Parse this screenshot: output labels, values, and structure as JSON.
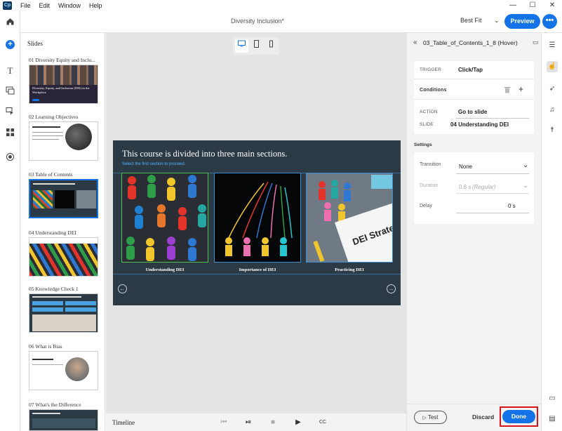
{
  "menubar": {
    "app_icon": "Cp",
    "items": [
      "File",
      "Edit",
      "Window",
      "Help"
    ]
  },
  "window_controls": {
    "minimize": "—",
    "maximize": "☐",
    "close": "✕"
  },
  "header": {
    "doc_title": "Diversity Inclusion*",
    "fit_label": "Best Fit",
    "preview_label": "Preview",
    "more_label": "•••"
  },
  "left_rail": {
    "icons": [
      "home-icon",
      "add-icon",
      "text-icon",
      "media-icon",
      "interactions-icon",
      "widgets-icon",
      "record-icon"
    ]
  },
  "slides_panel": {
    "title": "Slides",
    "slides": [
      {
        "label": "01  Diversity Equity and Inclu...",
        "thumb_text": "Diversity, Equity, and Inclusion (DEI) in the Workplace"
      },
      {
        "label": "02  Learning Objectives"
      },
      {
        "label": "03  Table of Contents"
      },
      {
        "label": "04  Understanding DEI"
      },
      {
        "label": "05  Knowledge Check 1"
      },
      {
        "label": "06  What is Bias"
      },
      {
        "label": "07  What's the Difference"
      }
    ]
  },
  "stage": {
    "heading": "This course is divided into three main sections.",
    "subheading": "Select the first section to proceed.",
    "cards": [
      {
        "label": "Understanding DEI"
      },
      {
        "label": "Importance of DEI"
      },
      {
        "label": "Practicing DEI",
        "sign_text": "DEI Strate"
      }
    ]
  },
  "timeline": {
    "label": "Timeline"
  },
  "properties": {
    "title": "03_Table_of_Contents_1_8 (Hover)",
    "trigger_key": "TRIGGER",
    "trigger_val": "Click/Tap",
    "conditions_label": "Conditions",
    "action_key": "ACTION",
    "action_val": "Go to slide",
    "slide_key": "SLIDE",
    "slide_val": "04 Understanding DEI",
    "settings_label": "Settings",
    "transition_key": "Transition",
    "transition_val": "None",
    "duration_key": "Duration",
    "duration_val": "0.8 s",
    "duration_hint": "(Regular)",
    "delay_key": "Delay",
    "delay_val": "0 s",
    "test_label": "Test",
    "discard_label": "Discard",
    "done_label": "Done"
  },
  "right_rail": {
    "icons": [
      "properties-icon",
      "interactions-icon",
      "animation-icon",
      "audio-icon",
      "accessibility-icon",
      "slides-layout-icon",
      "page-icon"
    ]
  },
  "colors": {
    "accent": "#1473e6",
    "stage_bg": "#2b3a45",
    "highlight": "#d7141a"
  }
}
